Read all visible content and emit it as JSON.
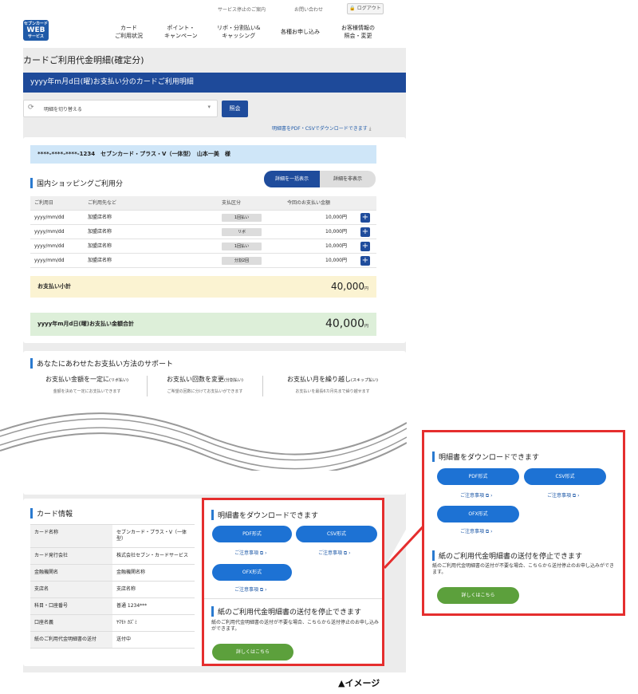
{
  "header": {
    "service_notice": "サービス停止のご案内",
    "contact": "お問い合わせ",
    "logout": "ログアウト",
    "logo_top": "セブンカード",
    "logo_main": "WEB",
    "logo_bottom": "サービス",
    "nav": [
      {
        "l1": "カード",
        "l2": "ご利用状況"
      },
      {
        "l1": "ポイント・",
        "l2": "キャンペーン"
      },
      {
        "l1": "リボ・分割払い&",
        "l2": "キャッシング"
      },
      {
        "l1": "各種お申し込み",
        "l2": ""
      },
      {
        "l1": "お客様情報の",
        "l2": "照会・変更"
      }
    ]
  },
  "page_title": "カードご利用代金明細(確定分)",
  "band_title": "yyyy年m月d日(曜)お支払い分のカードご利用明細",
  "selector": {
    "label": "明細を切り替える",
    "button": "照会"
  },
  "download_link": "明細書をPDF・CSVでダウンロードできます",
  "card_line": "****-****-****-1234　セブンカード・プラス・V（一体型）　山本一美　様",
  "domestic": {
    "title": "国内ショッピングご利用分",
    "toggle_on": "詳細を一括表示",
    "toggle_off": "詳細を非表示",
    "headers": [
      "ご利用日",
      "ご利用先など",
      "支払区分",
      "今回のお支払い金額"
    ],
    "rows": [
      {
        "date": "yyyy/mm/dd",
        "shop": "加盟店名称",
        "type": "1回払い",
        "amount": "10,000円"
      },
      {
        "date": "yyyy/mm/dd",
        "shop": "加盟店名称",
        "type": "リボ",
        "amount": "10,000円"
      },
      {
        "date": "yyyy/mm/dd",
        "shop": "加盟店名称",
        "type": "1回払い",
        "amount": "10,000円"
      },
      {
        "date": "yyyy/mm/dd",
        "shop": "加盟店名称",
        "type": "分割2回",
        "amount": "10,000円"
      }
    ],
    "subtotal_label": "お支払い小計",
    "subtotal_value": "40,000",
    "yen": "円",
    "total_label": "yyyy年m月d日(曜)お支払い金額合計",
    "total_value": "40,000"
  },
  "support": {
    "title": "あなたにあわせたお支払い方法のサポート",
    "cols": [
      {
        "h": "お支払い金額を一定に",
        "s": "(リボ払い)",
        "d": "金額を決めて一定にお支払いできます"
      },
      {
        "h": "お支払い回数を変更",
        "s": "(分割払い)",
        "d": "ご希望の回数に分けてお支払いができます"
      },
      {
        "h": "お支払い月を繰り越し",
        "s": "(スキップ払い)",
        "d": "お支払いを最長6カ月先まで繰り越せます"
      }
    ]
  },
  "card_info": {
    "title": "カード情報",
    "rows": [
      {
        "k": "カード名称",
        "v": "セブンカード・プラス・V（一体型）"
      },
      {
        "k": "カード発行会社",
        "v": "株式会社セブン・カードサービス"
      },
      {
        "k": "金融機関名",
        "v": "金融機関名称"
      },
      {
        "k": "支店名",
        "v": "支店名称"
      },
      {
        "k": "科目・口座番号",
        "v": "普通 1234***"
      },
      {
        "k": "口座名義",
        "v": "ﾔﾏﾓﾄ ｶｽﾞﾐ"
      },
      {
        "k": "紙のご利用代金明細書の送付",
        "v": "送付中"
      }
    ]
  },
  "dl": {
    "title": "明細書をダウンロードできます",
    "pdf": "PDF形式",
    "csv": "CSV形式",
    "ofx": "OFX形式",
    "note": "ご注意事項",
    "paper_title": "紙のご利用代金明細書の送付を停止できます",
    "paper_text": "紙のご利用代金明細書の送付が不要な場合、こちらから送付停止のお申し込みができます。",
    "detail_btn": "詳しくはこちら"
  },
  "caption": "▲イメージ",
  "colors": {
    "brand_blue": "#1e4a9a",
    "highlight_red": "#e52e2e",
    "button_blue": "#1d72d4",
    "button_green": "#5ca03c"
  }
}
